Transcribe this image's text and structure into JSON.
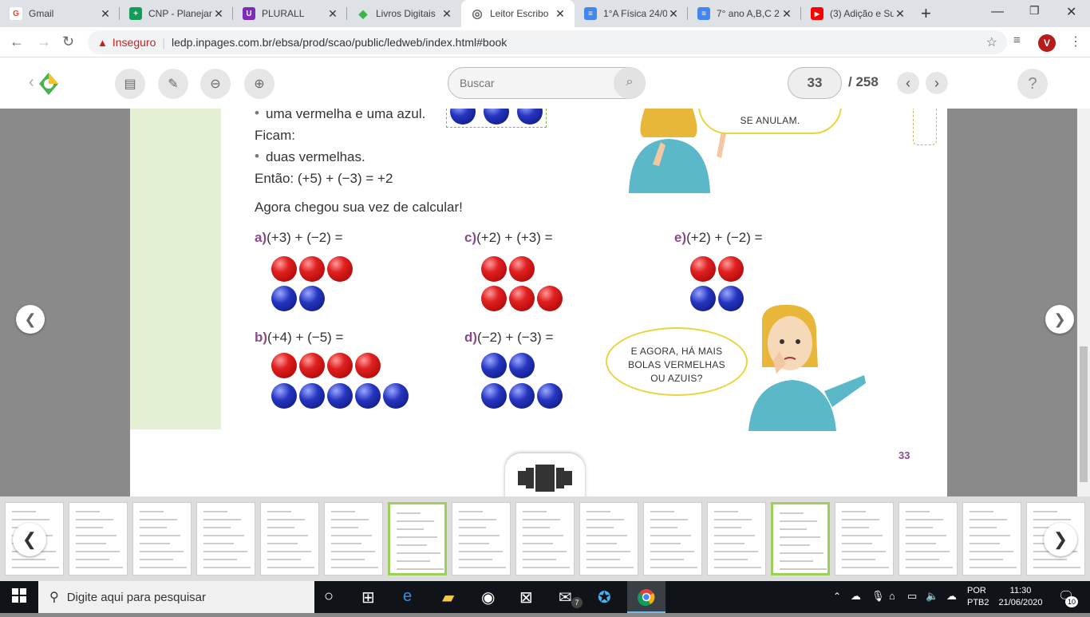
{
  "tabs": [
    {
      "title": "Gmail",
      "color": "#ea4335",
      "glyph": "G"
    },
    {
      "title": "CNP - Planejar",
      "color": "#0f9d58",
      "glyph": "+"
    },
    {
      "title": "PLURALL",
      "color": "#7b2cbf",
      "glyph": "U"
    },
    {
      "title": "Livros Digitais",
      "color": "#39b54a",
      "glyph": "◆"
    },
    {
      "title": "Leitor Escribo",
      "color": "#5f6368",
      "glyph": "◎"
    },
    {
      "title": "1°A Física 24/0",
      "color": "#4285f4",
      "glyph": "≡"
    },
    {
      "title": "7° ano A,B,C 2",
      "color": "#4285f4",
      "glyph": "≡"
    },
    {
      "title": "(3) Adição e Su",
      "color": "#ff0000",
      "glyph": "▶"
    }
  ],
  "address": {
    "insecure": "Inseguro",
    "url": "ledp.inpages.com.br/ebsa/prod/scao/public/ledweb/index.html#book",
    "profile": "V"
  },
  "toolbar": {
    "search_placeholder": "Buscar",
    "page": "33",
    "total": "/ 258",
    "help": "?"
  },
  "book": {
    "line1": "uma vermelha e uma azul.",
    "line2": "Ficam:",
    "line3": "duas vermelhas.",
    "line4": "Então: (+5) + (−3) = +2",
    "intro": "Agora chegou sua vez de calcular!",
    "exercises": [
      {
        "label": "a)",
        "expr": "(+3) + (−2) ="
      },
      {
        "label": "b)",
        "expr": "(+4) + (−5) ="
      },
      {
        "label": "c)",
        "expr": "(+2) + (+3) ="
      },
      {
        "label": "d)",
        "expr": "(−2) + (−3) ="
      },
      {
        "label": "e)",
        "expr": "(+2) + (−2) ="
      }
    ],
    "bubble_top": "SE ANULAM.",
    "bubble_main": [
      "E AGORA, HÁ MAIS",
      "BOLAS VERMELHAS",
      "OU AZUIS?"
    ],
    "page_number": "33"
  },
  "taskbar": {
    "search": "Digite aqui para pesquisar",
    "lang1": "POR",
    "lang2": "PTB2",
    "time": "11:30",
    "date": "21/06/2020",
    "mail_badge": "7",
    "notif": "10"
  }
}
